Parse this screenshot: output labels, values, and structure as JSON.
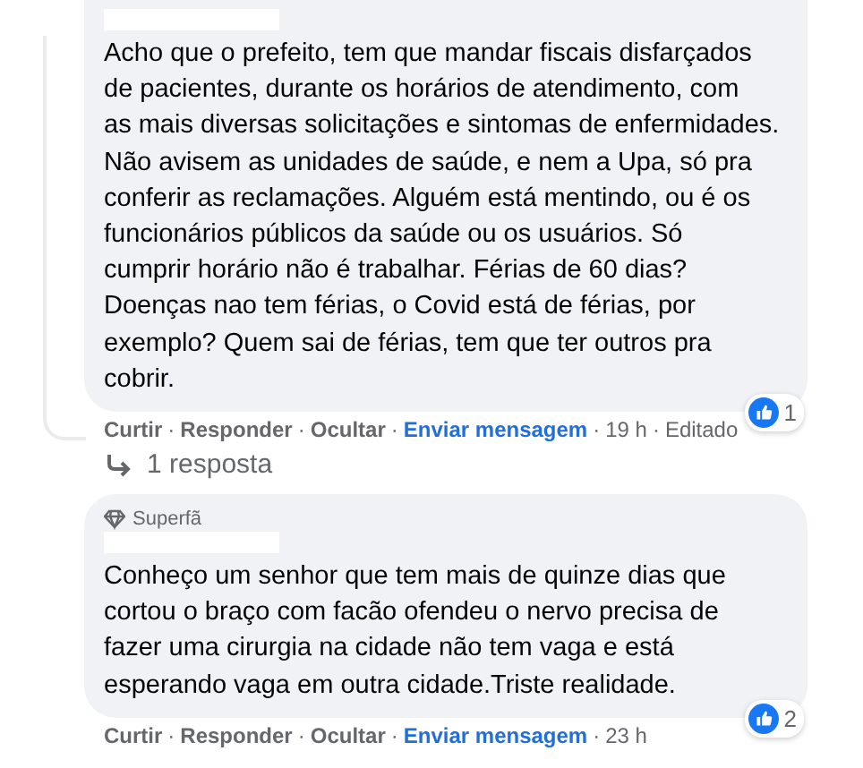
{
  "comments": [
    {
      "separator": "·",
      "text_lines": [
        "Acho que o prefeito, tem que mandar fiscais disfarçados",
        "de pacientes, durante os horários de atendimento, com",
        "as mais diversas solicitações e sintomas de enfermidades.",
        "Não avisem as unidades de saúde, e nem a Upa, só pra",
        "conferir as reclamações. Alguém está mentindo, ou é os",
        "funcionários públicos da saúde ou os usuários. Só",
        "cumprir horário não é trabalhar. Férias de 60 dias?",
        "Doenças nao tem férias, o Covid está de férias, por",
        "exemplo? Quem sai de férias, tem que ter outros pra",
        "cobrir."
      ],
      "reactions": "1",
      "actions": [
        {
          "label": "Curtir",
          "kind": "action"
        },
        {
          "label": "Responder",
          "kind": "action"
        },
        {
          "label": "Ocultar",
          "kind": "action"
        },
        {
          "label": "Enviar mensagem",
          "kind": "link"
        },
        {
          "label": "19 h",
          "kind": "meta"
        },
        {
          "label": "Editado",
          "kind": "meta"
        }
      ],
      "replies": "1 resposta"
    },
    {
      "separator": "·",
      "badge": "Superfã",
      "text_lines": [
        "Conheço um senhor que tem mais de quinze dias que",
        "cortou o braço com facão ofendeu o nervo precisa de",
        "fazer uma cirurgia na cidade não tem vaga e está",
        "esperando vaga em outra cidade.Triste realidade."
      ],
      "reactions": "2",
      "actions": [
        {
          "label": "Curtir",
          "kind": "action"
        },
        {
          "label": "Responder",
          "kind": "action"
        },
        {
          "label": "Ocultar",
          "kind": "action"
        },
        {
          "label": "Enviar mensagem",
          "kind": "link"
        },
        {
          "label": "23 h",
          "kind": "meta"
        }
      ]
    }
  ]
}
